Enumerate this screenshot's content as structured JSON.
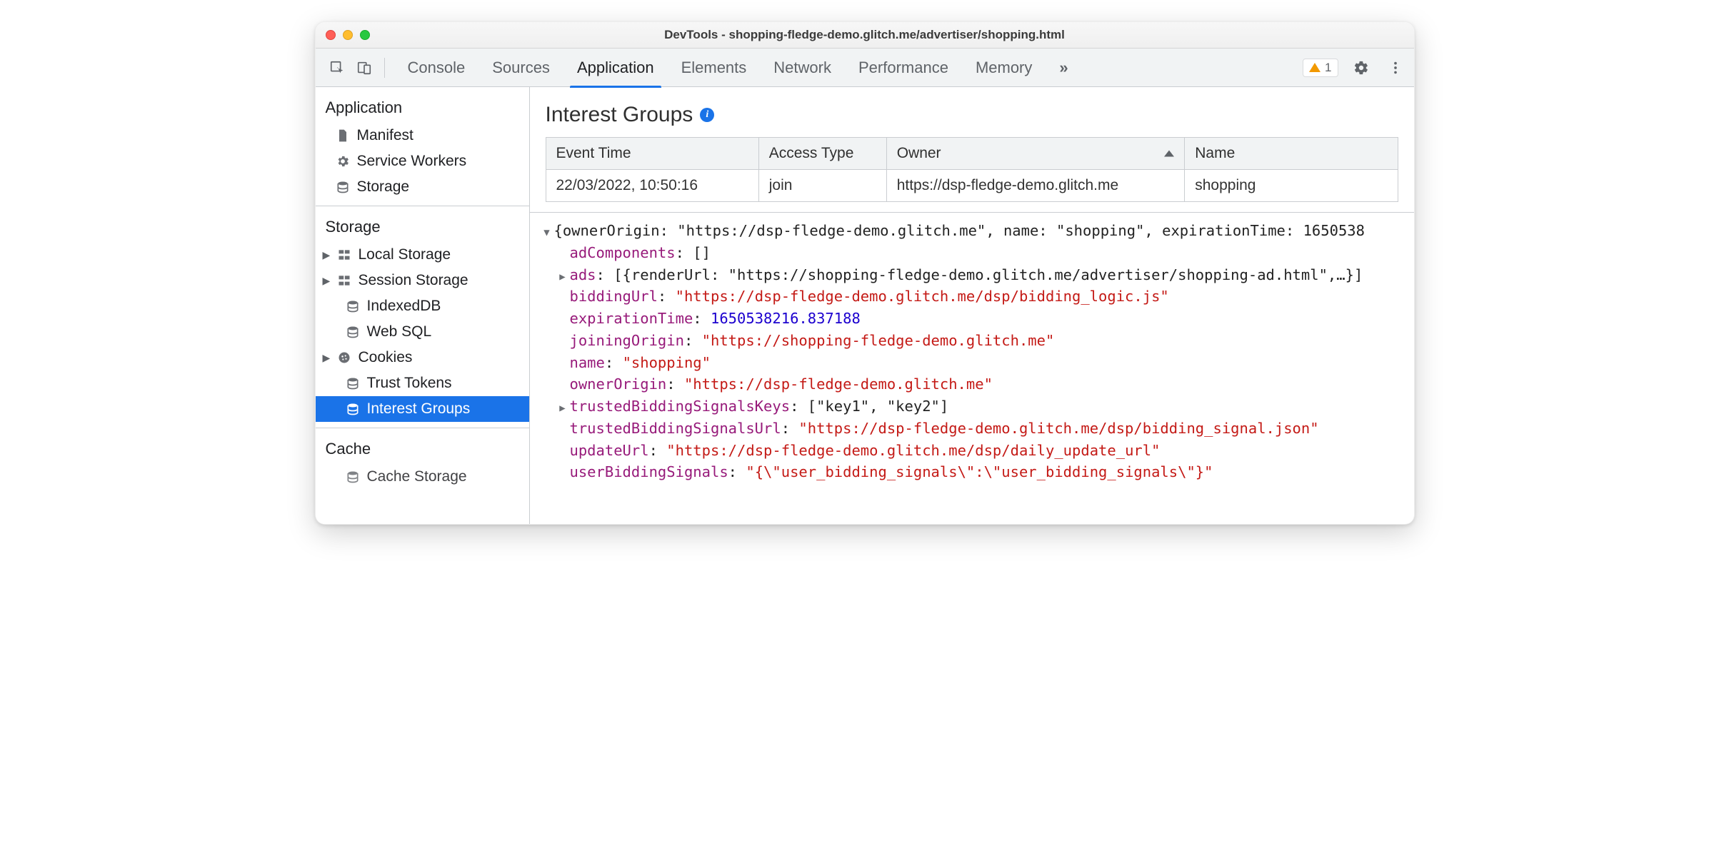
{
  "window": {
    "title": "DevTools - shopping-fledge-demo.glitch.me/advertiser/shopping.html"
  },
  "toolbar": {
    "tabs": [
      "Console",
      "Sources",
      "Application",
      "Elements",
      "Network",
      "Performance",
      "Memory"
    ],
    "active_tab": "Application",
    "warning_count": "1"
  },
  "sidebar": {
    "sections": [
      {
        "heading": "Application",
        "items": [
          {
            "icon": "file",
            "label": "Manifest"
          },
          {
            "icon": "gear",
            "label": "Service Workers"
          },
          {
            "icon": "db",
            "label": "Storage"
          }
        ]
      },
      {
        "heading": "Storage",
        "items": [
          {
            "icon": "grid",
            "label": "Local Storage",
            "caret": true
          },
          {
            "icon": "grid",
            "label": "Session Storage",
            "caret": true
          },
          {
            "icon": "db",
            "label": "IndexedDB"
          },
          {
            "icon": "db",
            "label": "Web SQL"
          },
          {
            "icon": "cookie",
            "label": "Cookies",
            "caret": true
          },
          {
            "icon": "db",
            "label": "Trust Tokens"
          },
          {
            "icon": "db",
            "label": "Interest Groups",
            "selected": true
          }
        ]
      },
      {
        "heading": "Cache",
        "items": [
          {
            "icon": "db",
            "label": "Cache Storage"
          }
        ]
      }
    ]
  },
  "content": {
    "title": "Interest Groups",
    "table": {
      "columns": [
        "Event Time",
        "Access Type",
        "Owner",
        "Name"
      ],
      "sort_column": "Owner",
      "rows": [
        [
          "22/03/2022, 10:50:16",
          "join",
          "https://dsp-fledge-demo.glitch.me",
          "shopping"
        ]
      ]
    },
    "object": {
      "summary": "{ownerOrigin: \"https://dsp-fledge-demo.glitch.me\", name: \"shopping\", expirationTime: 1650538",
      "adComponents": "[]",
      "ads_summary": "[{renderUrl: \"https://shopping-fledge-demo.glitch.me/advertiser/shopping-ad.html\",…}]",
      "biddingUrl": "\"https://dsp-fledge-demo.glitch.me/dsp/bidding_logic.js\"",
      "expirationTime": "1650538216.837188",
      "joiningOrigin": "\"https://shopping-fledge-demo.glitch.me\"",
      "name": "\"shopping\"",
      "ownerOrigin": "\"https://dsp-fledge-demo.glitch.me\"",
      "trustedBiddingSignalsKeys": "[\"key1\", \"key2\"]",
      "trustedBiddingSignalsUrl": "\"https://dsp-fledge-demo.glitch.me/dsp/bidding_signal.json\"",
      "updateUrl": "\"https://dsp-fledge-demo.glitch.me/dsp/daily_update_url\"",
      "userBiddingSignals": "\"{\\\"user_bidding_signals\\\":\\\"user_bidding_signals\\\"}\""
    }
  }
}
